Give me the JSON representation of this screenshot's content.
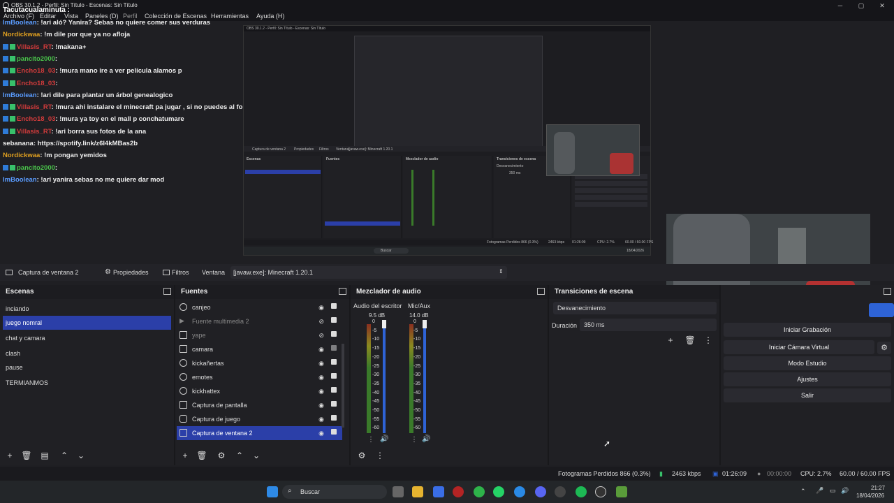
{
  "window": {
    "title": "OBS 30.1.2 - Perfil: Sin Título - Escenas: Sin Título",
    "overlay_text": "Tacutacualaminuta :"
  },
  "menu": [
    "Archivo (F)",
    "Editar",
    "Vista",
    "Paneles (D)",
    "Perfil",
    "Colección de Escenas",
    "Herramientas",
    "Ayuda (H)"
  ],
  "chat": [
    {
      "user": "ImBoolean",
      "text": ": !ari aló? Yanira? Sebas no quiere comer sus verduras",
      "color": "#5a9cff",
      "badge": false
    },
    {
      "user": "Nordickwaa",
      "text": ": !m dile por que ya no afloja",
      "color": "#e0a020",
      "badge": false
    },
    {
      "user": "Villasis_RT",
      "text": ": !makana+",
      "color": "#d23b3b",
      "badge": true
    },
    {
      "user": "pancito2000",
      "text": ":",
      "color": "#49c04a",
      "badge": true
    },
    {
      "user": "Encho18_03",
      "text": ": !mura mano ire a ver película alamos p",
      "color": "#d23b3b",
      "badge": true
    },
    {
      "user": "Encho18_03",
      "text": ":",
      "color": "#d23b3b",
      "badge": true
    },
    {
      "user": "ImBoolean",
      "text": ": !ari dile para plantar un árbol genealogico",
      "color": "#5a9cff",
      "badge": false
    },
    {
      "user": "Villasis_RT",
      "text": ": !mura ahi instalare el minecraft pa jugar , si no puedes al fort",
      "color": "#d23b3b",
      "badge": true
    },
    {
      "user": "Encho18_03",
      "text": ": !mura ya toy en el mall p conchatumare",
      "color": "#d23b3b",
      "badge": true
    },
    {
      "user": "Villasis_RT",
      "text": ": !ari borra sus fotos de la ana",
      "color": "#d23b3b",
      "badge": true
    },
    {
      "user": "sebanana",
      "text": ": https://spotify.link/z6I4kMBas2b",
      "color": "#eeeeee",
      "badge": false
    },
    {
      "user": "Nordickwaa",
      "text": ": !m pongan yemidos",
      "color": "#e0a020",
      "badge": false
    },
    {
      "user": "pancito2000",
      "text": ":",
      "color": "#49c04a",
      "badge": true
    },
    {
      "user": "ImBoolean",
      "text": ": !ari yanira sebas no me quiere dar mod",
      "color": "#5a9cff",
      "badge": false
    }
  ],
  "source_bar": {
    "source_name": "Captura de ventana 2",
    "properties": "Propiedades",
    "filters": "Filtros",
    "window_label": "Ventana",
    "window_value": "[javaw.exe]: Minecraft 1.20.1"
  },
  "scenes": {
    "title": "Escenas",
    "items": [
      "inciando",
      "juego nomral",
      "chat y camara",
      "clash",
      "pause",
      "TERMIANMOS"
    ]
  },
  "sources": {
    "title": "Fuentes",
    "items": [
      "canjeo",
      "Fuente multimedia 2",
      "yape",
      "camara",
      "kickañertas",
      "emotes",
      "kickhattex",
      "Captura de pantalla",
      "Captura de juego",
      "Captura de ventana 2"
    ]
  },
  "mixer": {
    "title": "Mezclador de audio",
    "channels": [
      {
        "name": "Audio del escritor",
        "db": "9.5 dB"
      },
      {
        "name": "Mic/Aux",
        "db": "14.0 dB"
      }
    ],
    "ticks": [
      "0",
      "-5",
      "-10",
      "-15",
      "-20",
      "-25",
      "-30",
      "-35",
      "-40",
      "-45",
      "-50",
      "-55",
      "-60"
    ]
  },
  "transitions": {
    "title": "Transiciones de escena",
    "type": "Desvanecimiento",
    "duration_label": "Duración",
    "duration": "350 ms"
  },
  "controls": {
    "buttons": [
      "Iniciar Grabación",
      "Iniciar Cámara Virtual",
      "Modo Estudio",
      "Ajustes",
      "Salir"
    ]
  },
  "status": {
    "dropped": "Fotogramas Perdidos 866 (0.3%)",
    "bitrate": "2463 kbps",
    "stream_time": "01:26:09",
    "rec_time": "00:00:00",
    "cpu": "CPU: 2.7%",
    "fps": "60.00 / 60.00 FPS"
  },
  "taskbar": {
    "search": "Buscar",
    "time": "21:27",
    "date": "18/04/2026"
  },
  "nested": {
    "title": "OBS 30.1.2 - Perfil: Sin Título - Escenas: Sin Título",
    "source_name": "Captura de ventana 2",
    "properties": "Propiedades",
    "filters": "Filtros",
    "window_label": "Ventana",
    "window_value": "[javaw.exe]: Minecraft 1.20.1",
    "scenes_title": "Escenas",
    "sources_title": "Fuentes",
    "mixer_title": "Mezclador de audio",
    "transitions_title": "Transiciones de escena",
    "fade": "Desvanecimiento",
    "duration_value": "350 ms",
    "search": "Buscar",
    "dropped": "Fotogramas Perdidos 866 (0.3%)",
    "bitrate": "2463 kbps",
    "stream_time": "01:26:09",
    "cpu": "CPU: 2.7%",
    "fps": "60.00 / 60.00 FPS",
    "datetime": "18/04/2026"
  }
}
